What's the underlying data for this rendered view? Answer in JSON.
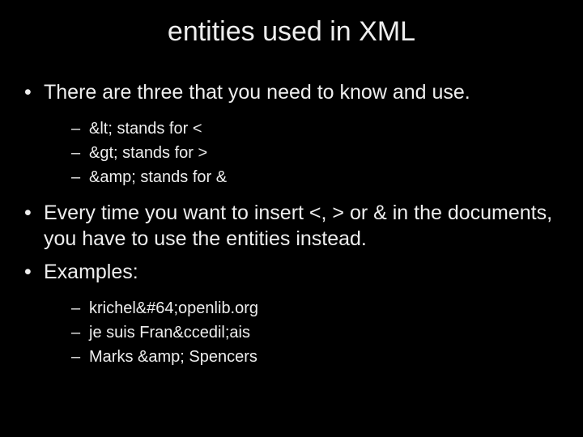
{
  "title": "entities used in XML",
  "bullets": {
    "b1": "There are three that you need to know and use.",
    "b1_sub": {
      "s1": "&lt; stands for <",
      "s2": "&gt; stands for >",
      "s3": "&amp; stands for &"
    },
    "b2": "Every time you want to insert <, >  or & in the documents, you have to use the entities instead.",
    "b3": "Examples:",
    "b3_sub": {
      "s1": "krichel&#64;openlib.org",
      "s2": "je suis Fran&ccedil;ais",
      "s3": "Marks &amp; Spencers"
    }
  }
}
